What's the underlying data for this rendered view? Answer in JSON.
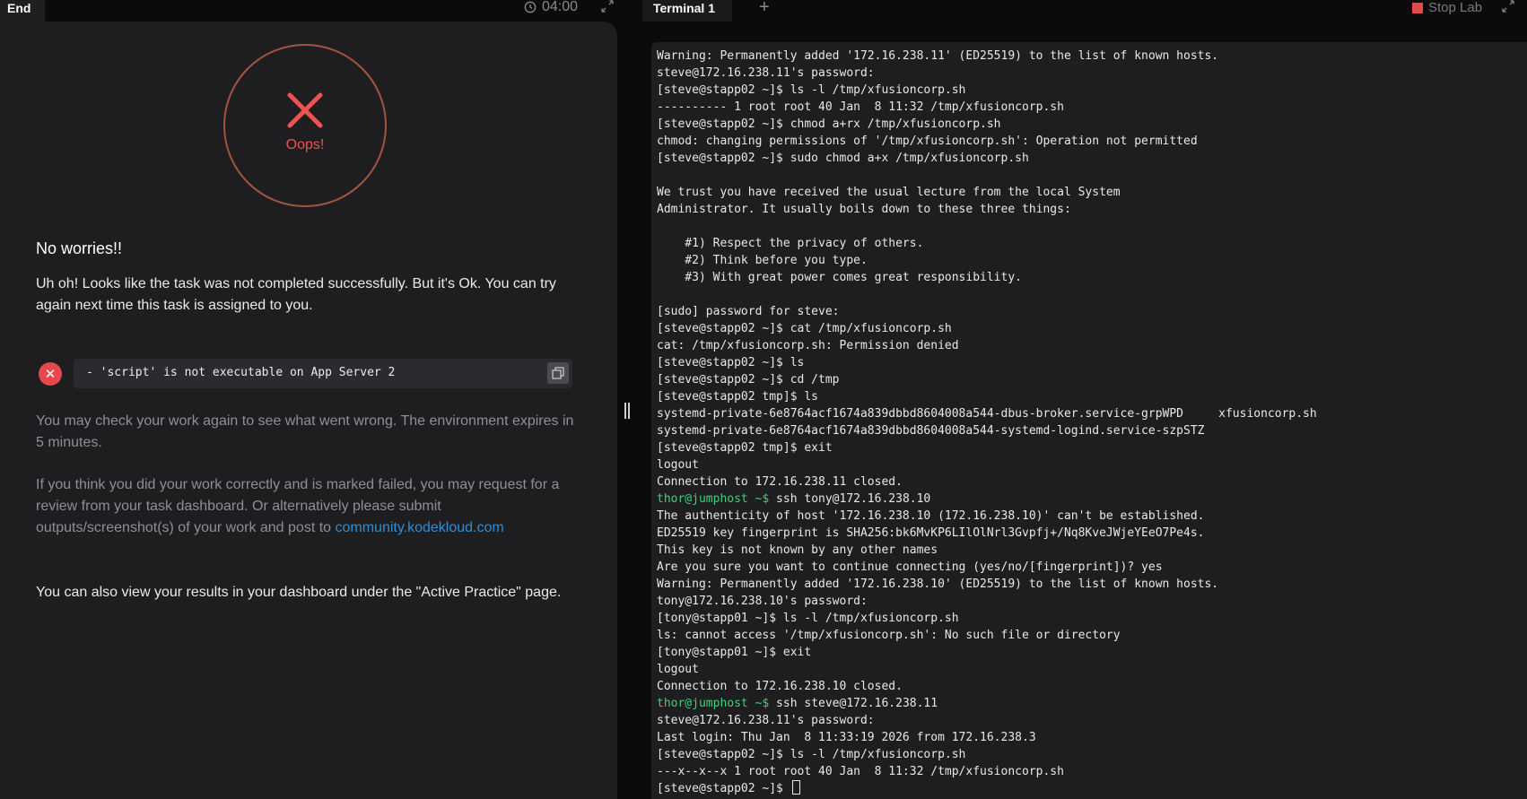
{
  "left": {
    "tab_label": "End",
    "timer": "04:00",
    "oops_label": "Oops!",
    "heading": "No worries!!",
    "message": "Uh oh! Looks like the task was not completed successfully. But it's Ok. You can try again next time this task is assigned to you.",
    "error_text": "- 'script' is not executable on App Server 2",
    "check_text": "You may check your work again to see what went wrong. The environment expires in 5 minutes.",
    "review_text": "If you think you did your work correctly and is marked failed, you may request for a review from your task dashboard. Or alternatively please submit outputs/screenshot(s) of your work and post to ",
    "community_link": "community.kodekloud.com",
    "dashboard_text": "You can also view your results in your dashboard under the \"Active Practice\" page."
  },
  "right": {
    "tab_label": "Terminal 1",
    "add_tab": "+",
    "stop_lab": "Stop Lab",
    "terminal": [
      {
        "text": "Warning: Permanently added '172.16.238.11' (ED25519) to the list of known hosts."
      },
      {
        "text": "steve@172.16.238.11's password:"
      },
      {
        "text": "[steve@stapp02 ~]$ ls -l /tmp/xfusioncorp.sh"
      },
      {
        "text": "---------- 1 root root 40 Jan  8 11:32 /tmp/xfusioncorp.sh"
      },
      {
        "text": "[steve@stapp02 ~]$ chmod a+rx /tmp/xfusioncorp.sh"
      },
      {
        "text": "chmod: changing permissions of '/tmp/xfusioncorp.sh': Operation not permitted"
      },
      {
        "text": "[steve@stapp02 ~]$ sudo chmod a+x /tmp/xfusioncorp.sh"
      },
      {
        "text": ""
      },
      {
        "text": "We trust you have received the usual lecture from the local System"
      },
      {
        "text": "Administrator. It usually boils down to these three things:"
      },
      {
        "text": ""
      },
      {
        "text": "    #1) Respect the privacy of others."
      },
      {
        "text": "    #2) Think before you type."
      },
      {
        "text": "    #3) With great power comes great responsibility."
      },
      {
        "text": ""
      },
      {
        "text": "[sudo] password for steve:"
      },
      {
        "text": "[steve@stapp02 ~]$ cat /tmp/xfusioncorp.sh"
      },
      {
        "text": "cat: /tmp/xfusioncorp.sh: Permission denied"
      },
      {
        "text": "[steve@stapp02 ~]$ ls"
      },
      {
        "text": "[steve@stapp02 ~]$ cd /tmp"
      },
      {
        "text": "[steve@stapp02 tmp]$ ls"
      },
      {
        "text": "systemd-private-6e8764acf1674a839dbbd8604008a544-dbus-broker.service-grpWPD     xfusioncorp.sh"
      },
      {
        "text": "systemd-private-6e8764acf1674a839dbbd8604008a544-systemd-logind.service-szpSTZ"
      },
      {
        "text": "[steve@stapp02 tmp]$ exit"
      },
      {
        "text": "logout"
      },
      {
        "text": "Connection to 172.16.238.11 closed."
      },
      {
        "prompt": "thor@jumphost ~$",
        "text": " ssh tony@172.16.238.10"
      },
      {
        "text": "The authenticity of host '172.16.238.10 (172.16.238.10)' can't be established."
      },
      {
        "text": "ED25519 key fingerprint is SHA256:bk6MvKP6LIlOlNrl3Gvpfj+/Nq8KveJWjeYEeO7Pe4s."
      },
      {
        "text": "This key is not known by any other names"
      },
      {
        "text": "Are you sure you want to continue connecting (yes/no/[fingerprint])? yes"
      },
      {
        "text": "Warning: Permanently added '172.16.238.10' (ED25519) to the list of known hosts."
      },
      {
        "text": "tony@172.16.238.10's password:"
      },
      {
        "text": "[tony@stapp01 ~]$ ls -l /tmp/xfusioncorp.sh"
      },
      {
        "text": "ls: cannot access '/tmp/xfusioncorp.sh': No such file or directory"
      },
      {
        "text": "[tony@stapp01 ~]$ exit"
      },
      {
        "text": "logout"
      },
      {
        "text": "Connection to 172.16.238.10 closed."
      },
      {
        "prompt": "thor@jumphost ~$",
        "text": " ssh steve@172.16.238.11"
      },
      {
        "text": "steve@172.16.238.11's password:"
      },
      {
        "text": "Last login: Thu Jan  8 11:33:19 2026 from 172.16.238.3"
      },
      {
        "text": "[steve@stapp02 ~]$ ls -l /tmp/xfusioncorp.sh"
      },
      {
        "text": "---x--x--x 1 root root 40 Jan  8 11:32 /tmp/xfusioncorp.sh"
      },
      {
        "text": "[steve@stapp02 ~]$ ",
        "cursor": true
      }
    ]
  },
  "colors": {
    "accent_red": "#e5484d",
    "prompt_green": "#3fd17a",
    "link_blue": "#2f8fd6"
  }
}
